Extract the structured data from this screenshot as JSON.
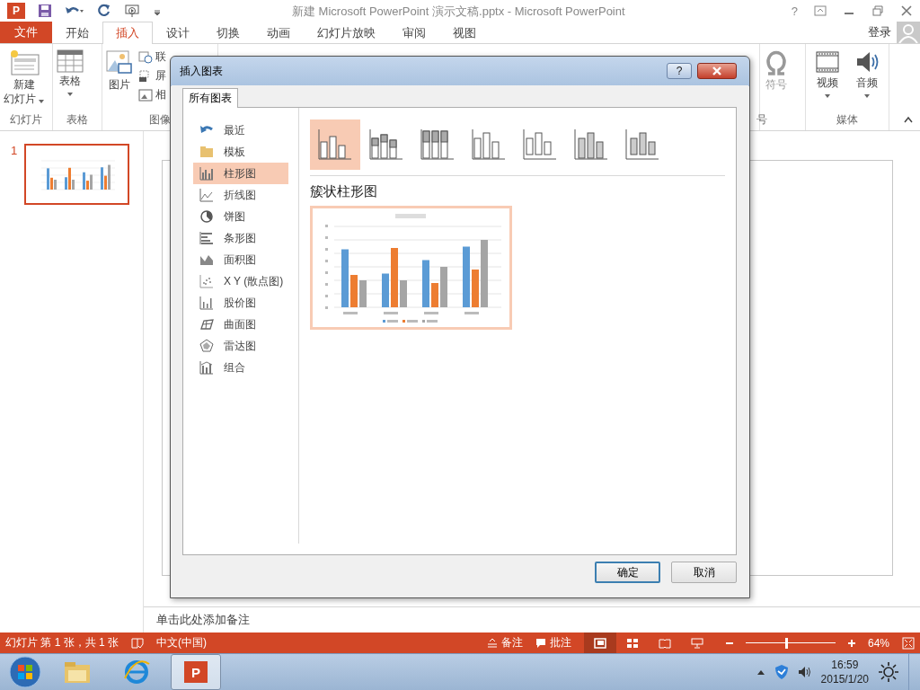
{
  "window": {
    "logo_letter": "P",
    "title": "新建 Microsoft PowerPoint 演示文稿.pptx - Microsoft PowerPoint",
    "help": "?"
  },
  "file_tab": "文件",
  "tabs": [
    {
      "label": "开始",
      "selected": false
    },
    {
      "label": "插入",
      "selected": true
    },
    {
      "label": "设计",
      "selected": false
    },
    {
      "label": "切换",
      "selected": false
    },
    {
      "label": "动画",
      "selected": false
    },
    {
      "label": "幻灯片放映",
      "selected": false
    },
    {
      "label": "审阅",
      "selected": false
    },
    {
      "label": "视图",
      "selected": false
    }
  ],
  "account": "登录",
  "ribbon": {
    "new_slide": "新建",
    "new_slide_2": "幻灯片",
    "slides_group": "幻灯片",
    "table": "表格",
    "table_group": "表格",
    "pictures": "图片",
    "online_pictures": "联",
    "screenshot": "屏",
    "album": "相",
    "images_group": "图像",
    "symbol": "符号",
    "symbols_group": "号",
    "video": "视频",
    "audio": "音频",
    "media_group": "媒体"
  },
  "thumbnails": [
    {
      "number": "1",
      "selected": true
    }
  ],
  "notes_placeholder": "单击此处添加备注",
  "status_bar": {
    "slide_info": "幻灯片 第 1 张，共 1 张",
    "language": "中文(中国)",
    "notes": "备注",
    "comments": "批注",
    "views": [
      {
        "selected": true
      },
      {
        "selected": false
      },
      {
        "selected": false
      },
      {
        "selected": false
      }
    ],
    "zoom_slider": {
      "level": 0.45
    },
    "zoom": "64%"
  },
  "dialog": {
    "title": "插入图表",
    "help": "?",
    "tab": "所有图表",
    "categories": [
      {
        "label": "最近",
        "selected": false
      },
      {
        "label": "模板",
        "selected": false
      },
      {
        "label": "柱形图",
        "selected": true
      },
      {
        "label": "折线图",
        "selected": false
      },
      {
        "label": "饼图",
        "selected": false
      },
      {
        "label": "条形图",
        "selected": false
      },
      {
        "label": "面积图",
        "selected": false
      },
      {
        "label": "X Y (散点图)",
        "selected": false
      },
      {
        "label": "股价图",
        "selected": false
      },
      {
        "label": "曲面图",
        "selected": false
      },
      {
        "label": "雷达图",
        "selected": false
      },
      {
        "label": "组合",
        "selected": false
      }
    ],
    "subtypes": [
      {
        "selected": true
      },
      {
        "selected": false
      },
      {
        "selected": false
      },
      {
        "selected": false
      },
      {
        "selected": false
      },
      {
        "selected": false
      },
      {
        "selected": false
      }
    ],
    "subtype_title": "簇状柱形图",
    "buttons": [
      {
        "label": "确定",
        "kind": "default"
      },
      {
        "label": "取消",
        "kind": "normal"
      }
    ]
  },
  "taskbar": {
    "apps": [
      {
        "active": false
      },
      {
        "active": false
      },
      {
        "active": true,
        "letter": "P"
      }
    ],
    "time": "16:59",
    "date": "2015/1/20"
  }
}
